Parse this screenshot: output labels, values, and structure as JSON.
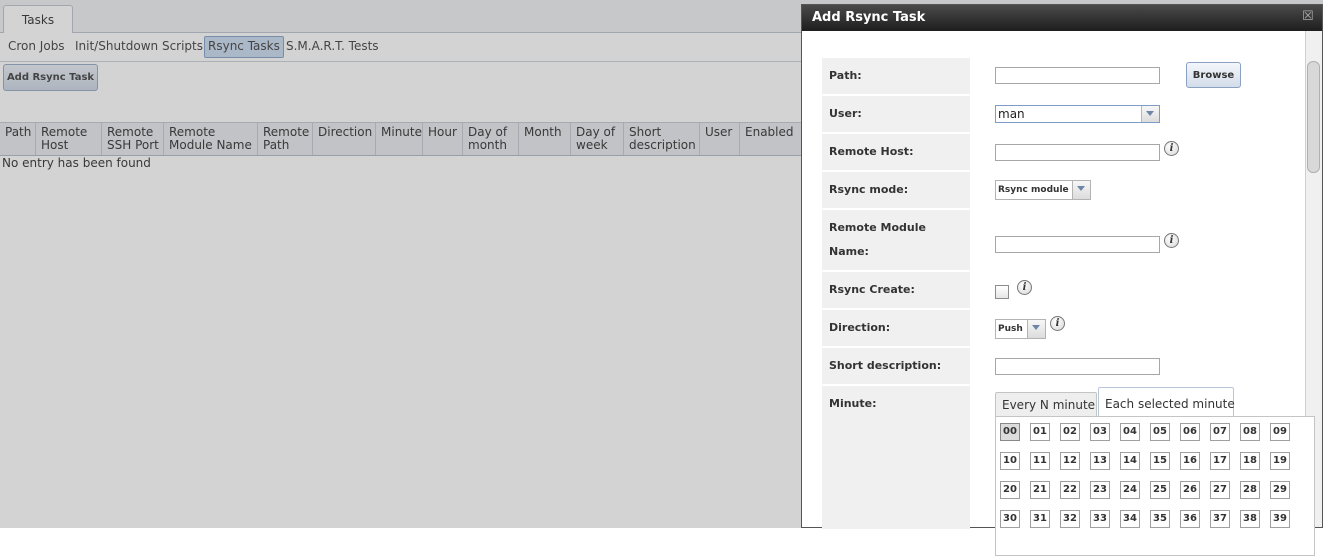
{
  "tabbar": {
    "main_tab": "Tasks"
  },
  "subnav": [
    "Cron Jobs",
    "Init/Shutdown Scripts",
    "Rsync Tasks",
    "S.M.A.R.T. Tests"
  ],
  "toolbar": {
    "add_label": "Add Rsync Task"
  },
  "grid": {
    "columns": [
      [
        "Path",
        ""
      ],
      [
        "Remote",
        "Host"
      ],
      [
        "Remote",
        "SSH Port"
      ],
      [
        "Remote",
        "Module Name"
      ],
      [
        "Remote",
        "Path"
      ],
      [
        "Direction",
        ""
      ],
      [
        "Minute",
        ""
      ],
      [
        "Hour",
        ""
      ],
      [
        "Day of",
        "month"
      ],
      [
        "Month",
        ""
      ],
      [
        "Day of",
        "week"
      ],
      [
        "Short",
        "description"
      ],
      [
        "User",
        ""
      ],
      [
        "Enabled",
        ""
      ]
    ],
    "empty_text": "No entry has been found"
  },
  "dialog": {
    "title": "Add Rsync Task",
    "close_glyph": "☒",
    "labels": {
      "path": "Path:",
      "user": "User:",
      "remote_host": "Remote Host:",
      "rsync_mode": "Rsync mode:",
      "remote_module_1": "Remote Module",
      "remote_module_2": "Name:",
      "rsync_create": "Rsync Create:",
      "direction": "Direction:",
      "short_desc": "Short description:",
      "minute": "Minute:"
    },
    "browse_label": "Browse",
    "user_value": "man",
    "rsync_mode_value": "Rsync module",
    "direction_value": "Push",
    "info_glyph": "i",
    "minute_tabs": [
      "Every N minute",
      "Each selected minute"
    ],
    "minutes": [
      "00",
      "01",
      "02",
      "03",
      "04",
      "05",
      "06",
      "07",
      "08",
      "09",
      "10",
      "11",
      "12",
      "13",
      "14",
      "15",
      "16",
      "17",
      "18",
      "19",
      "20",
      "21",
      "22",
      "23",
      "24",
      "25",
      "26",
      "27",
      "28",
      "29",
      "30",
      "31",
      "32",
      "33",
      "34",
      "35",
      "36",
      "37",
      "38",
      "39"
    ]
  }
}
